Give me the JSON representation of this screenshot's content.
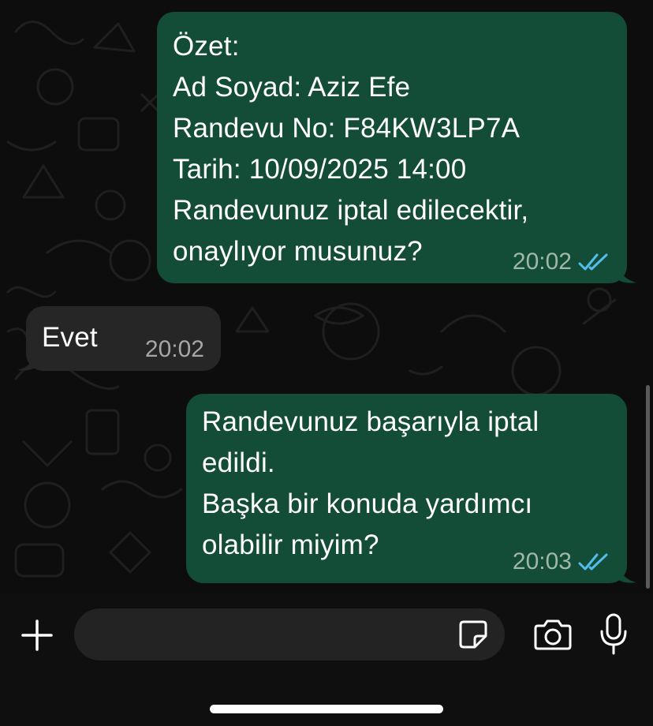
{
  "chat": {
    "messages": [
      {
        "direction": "outgoing",
        "text": "Özet:\nAd Soyad: Aziz Efe\nRandevu No: F84KW3LP7A\nTarih: 10/09/2025 14:00\nRandevunuz iptal edilecektir, onaylıyor musunuz?",
        "time": "20:02",
        "status": "read"
      },
      {
        "direction": "incoming",
        "text": "Evet",
        "time": "20:02"
      },
      {
        "direction": "outgoing",
        "text": "Randevunuz başarıyla iptal edildi.\nBaşka bir konuda yardımcı olabilir miyim?",
        "time": "20:03",
        "status": "read"
      }
    ]
  },
  "composer": {
    "placeholder": "",
    "icons": {
      "attach": "plus-icon",
      "sticker": "sticker-icon",
      "camera": "camera-icon",
      "mic": "microphone-icon"
    }
  },
  "colors": {
    "outgoing_bubble": "#144d37",
    "incoming_bubble": "#262626",
    "read_ticks": "#53bdeb",
    "background": "#0c0c0c"
  }
}
